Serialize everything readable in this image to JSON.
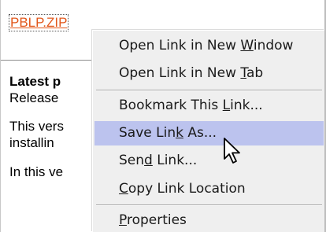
{
  "page": {
    "link_text": "PBLP.ZIP",
    "heading": "Latest p",
    "line1": "Release",
    "line2": "This vers",
    "line3": "installin",
    "line4": "In this ve"
  },
  "context_menu": {
    "items": [
      {
        "pre": "Open Link in New ",
        "key": "W",
        "post": "indow",
        "highlighted": false
      },
      {
        "pre": "Open Link in New ",
        "key": "T",
        "post": "ab",
        "highlighted": false
      },
      {
        "pre": "Bookmark This ",
        "key": "L",
        "post": "ink...",
        "highlighted": false
      },
      {
        "pre": "Save Lin",
        "key": "k",
        "post": " As...",
        "highlighted": true
      },
      {
        "pre": "Sen",
        "key": "d",
        "post": " Link...",
        "highlighted": false
      },
      {
        "pre": "",
        "key": "C",
        "post": "opy Link Location",
        "highlighted": false
      },
      {
        "pre": "",
        "key": "P",
        "post": "roperties",
        "highlighted": false
      }
    ]
  },
  "colors": {
    "link": "#e2571b",
    "menu_background": "#efefef",
    "menu_highlight": "#bcc3ee"
  },
  "cursor": {
    "icon": "arrow-pointer-icon"
  }
}
